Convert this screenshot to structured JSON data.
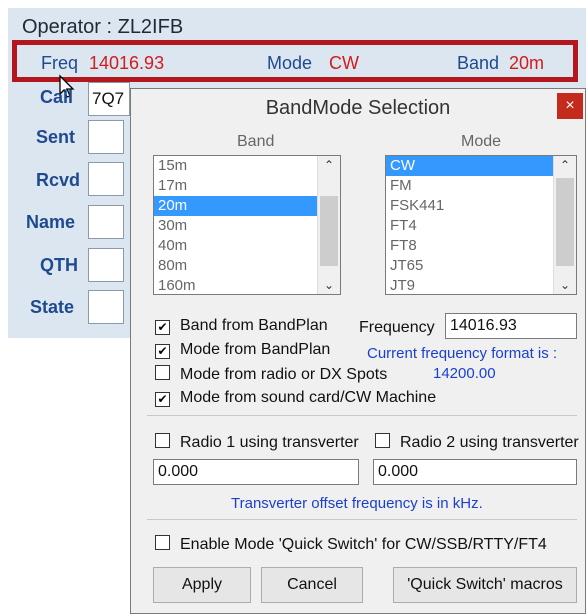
{
  "operator": "Operator : ZL2IFB",
  "strip": {
    "freq_label": "Freq",
    "freq_value": "14016.93",
    "mode_label": "Mode",
    "mode_value": "CW",
    "band_label": "Band",
    "band_value": "20m"
  },
  "left_fields": {
    "call_label": "Call",
    "call_value": "7Q7",
    "sent_label": "Sent",
    "rcvd_label": "Rcvd",
    "name_label": "Name",
    "qth_label": "QTH",
    "state_label": "State"
  },
  "dialog": {
    "title": "BandMode Selection",
    "close": "×",
    "band_header": "Band",
    "mode_header": "Mode",
    "bands": [
      "15m",
      "17m",
      "20m",
      "30m",
      "40m",
      "80m",
      "160m"
    ],
    "band_selected": "20m",
    "modes": [
      "CW",
      "FM",
      "FSK441",
      "FT4",
      "FT8",
      "JT65",
      "JT9"
    ],
    "mode_selected": "CW",
    "options": {
      "band_from_bandplan": "Band from BandPlan",
      "mode_from_bandplan": "Mode from BandPlan",
      "mode_from_radio": "Mode from radio or DX Spots",
      "mode_from_soundcard": "Mode from sound card/CW Machine"
    },
    "frequency_label": "Frequency",
    "frequency_value": "14016.93",
    "format_note": "Current frequency format is :",
    "format_example": "14200.00",
    "radio1_transverter": "Radio 1 using transverter",
    "radio2_transverter": "Radio 2 using transverter",
    "radio1_offset": "0.000",
    "radio2_offset": "0.000",
    "offset_note": "Transverter offset frequency is in kHz.",
    "quick_switch": "Enable Mode 'Quick Switch' for CW/SSB/RTTY/FT4",
    "apply": "Apply",
    "cancel": "Cancel",
    "quick_macros": "'Quick Switch' macros",
    "checked_mark": "✔"
  },
  "colors": {
    "accent_red": "#b3171d",
    "value_red": "#d31b1b",
    "label_blue": "#1f4a8f",
    "selection": "#3399ff",
    "note_blue": "#1a3fd0"
  }
}
